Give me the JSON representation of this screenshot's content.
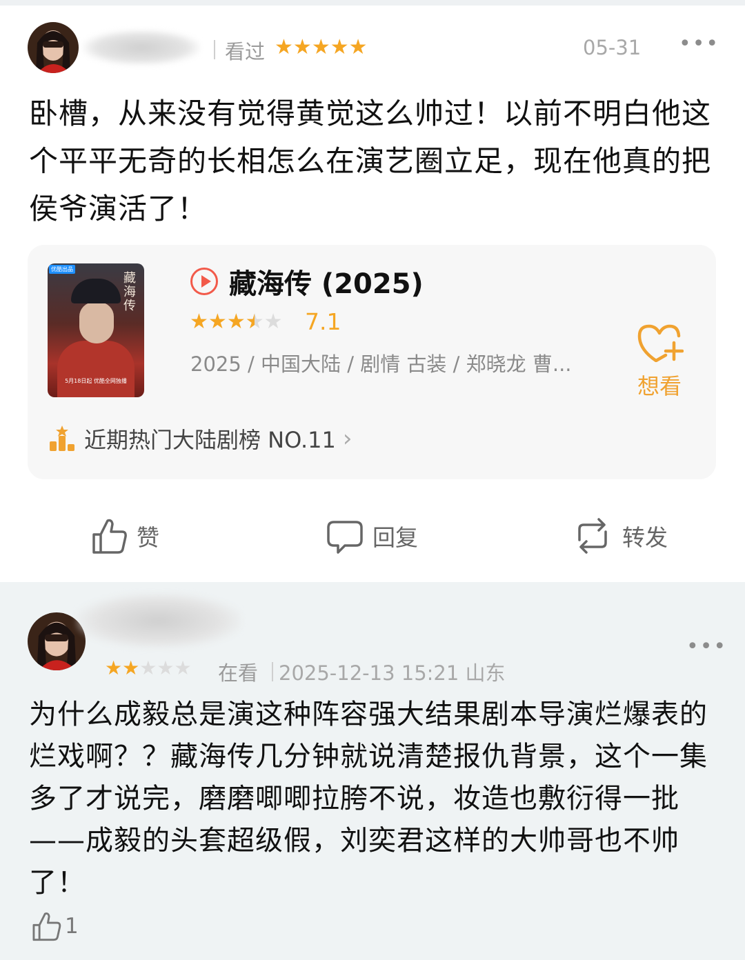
{
  "review1": {
    "status": "看过",
    "stars": 5,
    "date": "05-31",
    "more": "•••",
    "text": "卧槽，从来没有觉得黄觉这么帅过！以前不明白他这个平平无奇的长相怎么在演艺圈立足，现在他真的把侯爷演活了！",
    "card": {
      "title": "藏海传 (2025)",
      "rating_stars": 3.5,
      "rating": "7.1",
      "meta": "2025 / 中国大陆 / 剧情 古装 / 郑晓龙 曹...",
      "wish_label": "想看",
      "rank_text": "近期热门大陆剧榜 NO.11",
      "rank_chevron": "›",
      "poster_title": "藏海传",
      "poster_badge": "优酷出品",
      "poster_caption": "5月18日起 优酷全网独播"
    },
    "actions": {
      "like": "赞",
      "reply": "回复",
      "share": "转发"
    }
  },
  "review2": {
    "stars": 2,
    "status": "在看",
    "date": "2025-12-13 15:21 山东",
    "more": "•••",
    "text": "为什么成毅总是演这种阵容强大结果剧本导演烂爆表的烂戏啊？？藏海传几分钟就说清楚报仇背景，这个一集多了才说完，磨磨唧唧拉胯不说，妆造也敷衍得一批——成毅的头套超级假，刘奕君这样的大帅哥也不帅了！",
    "like_count": "1"
  },
  "colors": {
    "star": "#f5a623",
    "accent_orange": "#f0a230",
    "play_red": "#f25a4a",
    "background_gray": "#eff3f4"
  }
}
